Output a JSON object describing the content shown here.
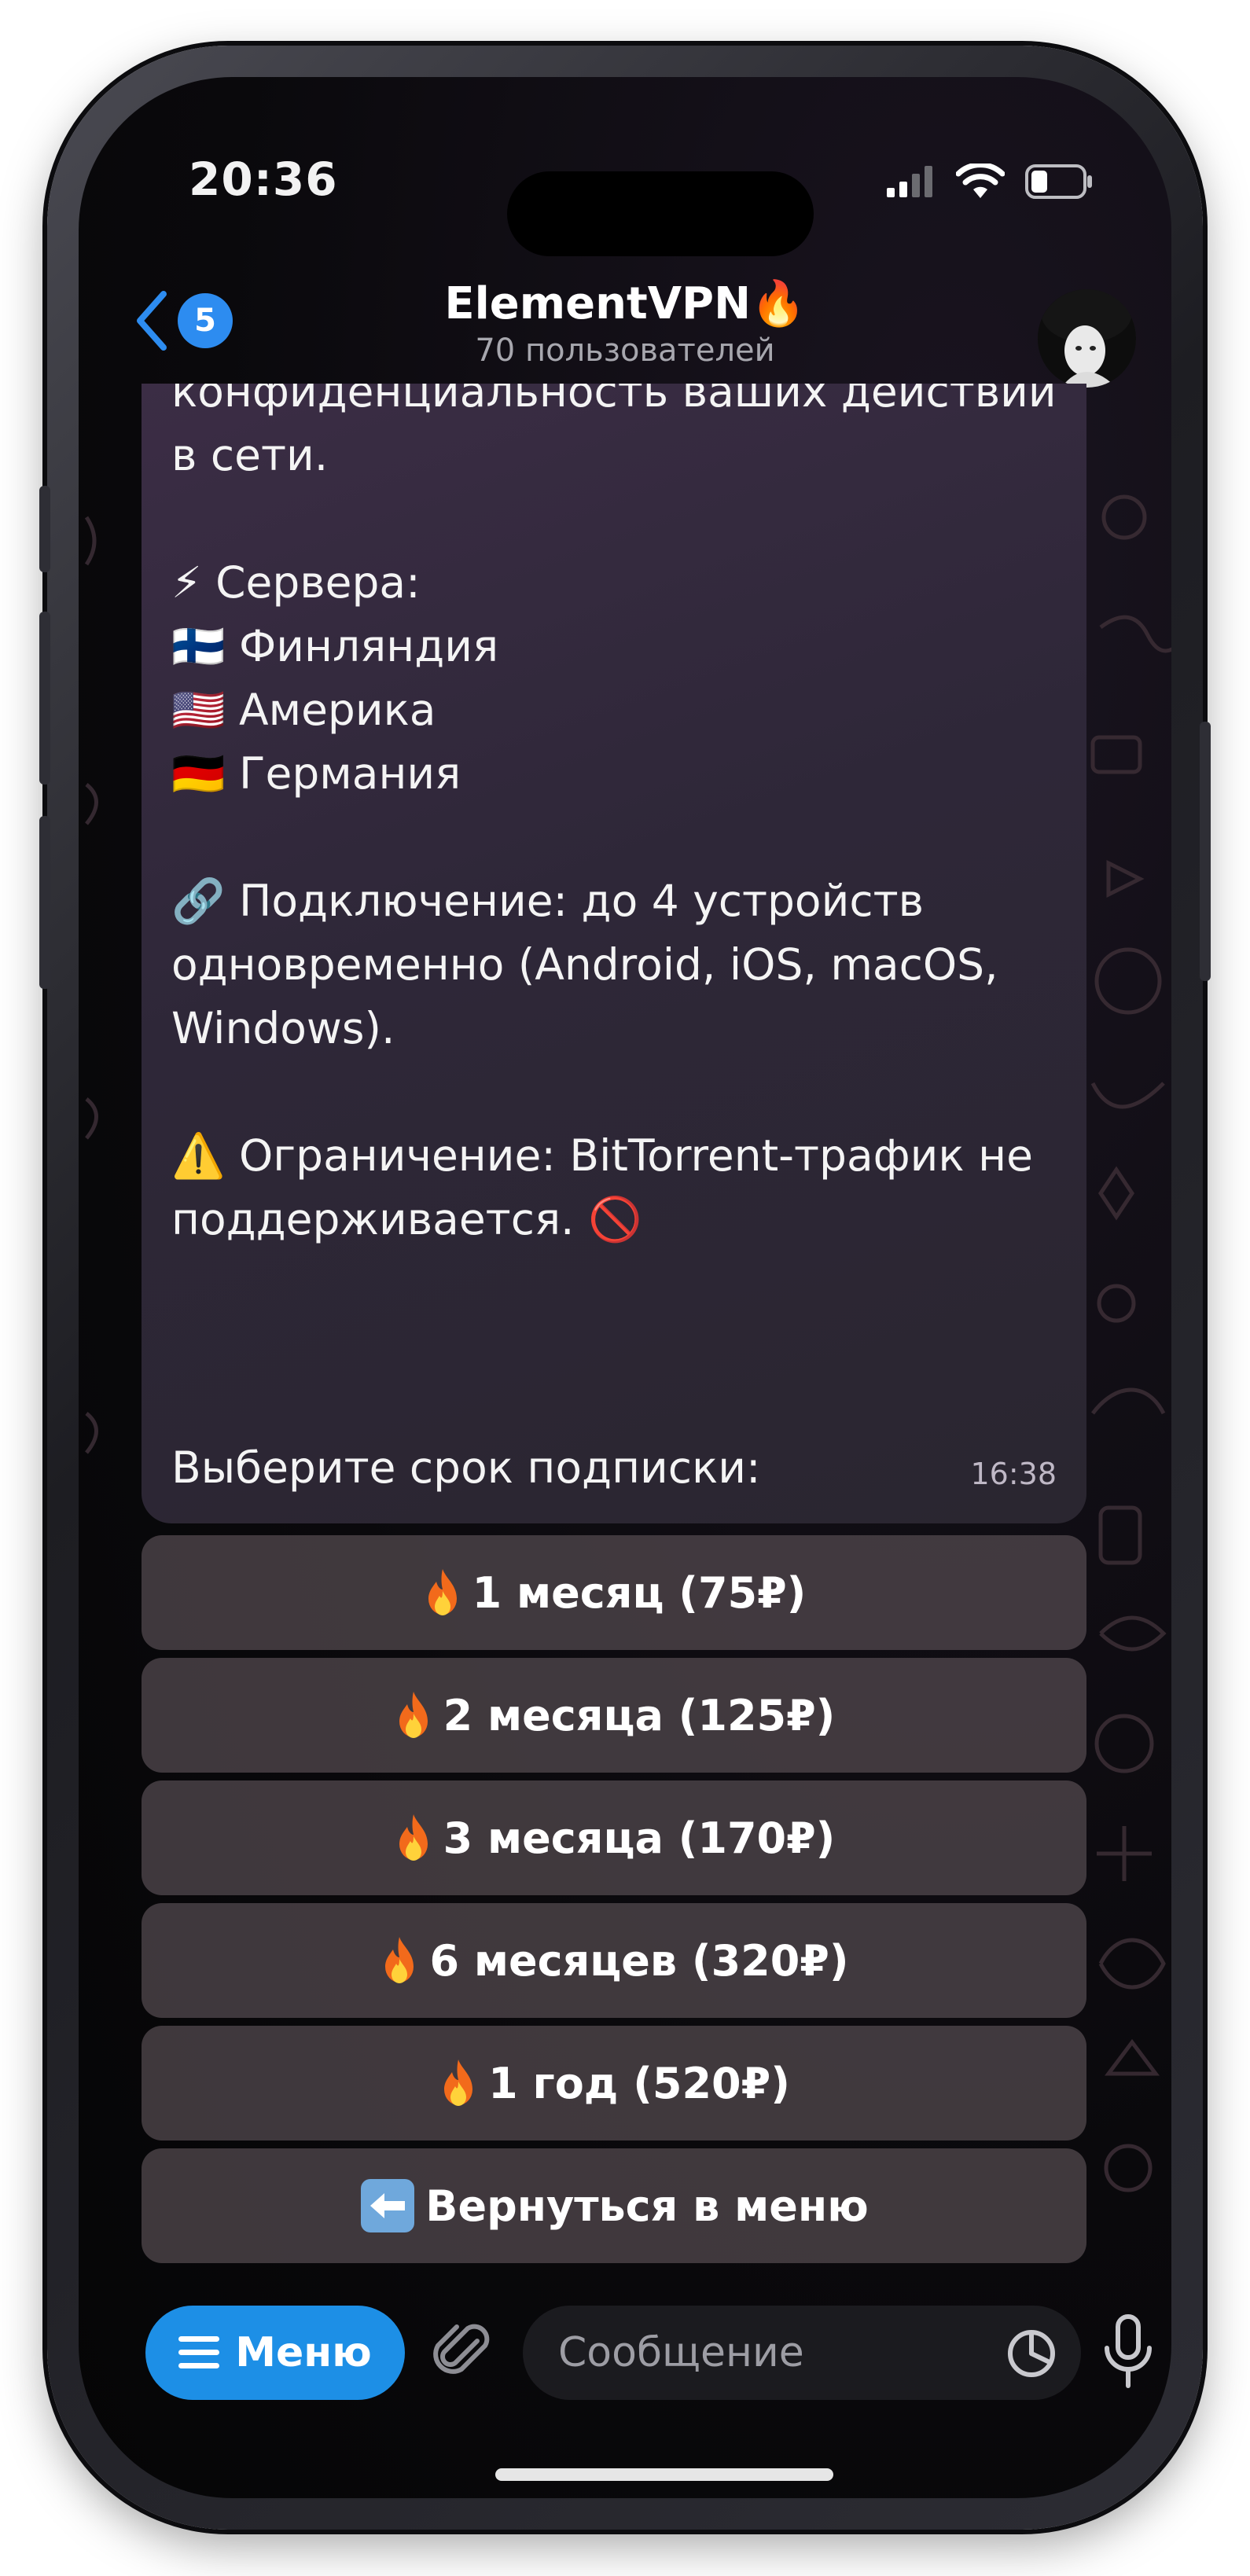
{
  "status_bar": {
    "time": "20:36"
  },
  "header": {
    "back_badge": "5",
    "title": "ElementVPN🔥",
    "subtitle": "70 пользователей"
  },
  "message": {
    "lines": [
      "конфиденциальность ваших действий",
      "в сети.",
      "",
      "⚡ Сервера:",
      "🇫🇮 Финляндия",
      "🇺🇸 Америка",
      "🇩🇪 Германия",
      "",
      "🔗 Подключение: до 4 устройств",
      "одновременно (Android, iOS, macOS,",
      "Windows).",
      "",
      "⚠️ Ограничение: BitTorrent-трафик не",
      "поддерживается. 🚫"
    ],
    "prompt": "Выберите срок подписки:",
    "time": "16:38"
  },
  "keyboard": {
    "buttons": [
      {
        "label": "1 месяц (75₽)",
        "icon": "fire-icon"
      },
      {
        "label": "2 месяца (125₽)",
        "icon": "fire-icon"
      },
      {
        "label": "3 месяца (170₽)",
        "icon": "fire-icon"
      },
      {
        "label": "6 месяцев (320₽)",
        "icon": "fire-icon"
      },
      {
        "label": "1 год (520₽)",
        "icon": "fire-icon"
      },
      {
        "label": "Вернуться в меню",
        "icon": "back-arrow-icon"
      }
    ]
  },
  "bottom_bar": {
    "menu_label": "Меню",
    "input_placeholder": "Сообщение"
  },
  "colors": {
    "accent": "#1d8fe6",
    "badge": "#2d8cf0",
    "bubble": "#2e2738",
    "button": "#504648"
  }
}
